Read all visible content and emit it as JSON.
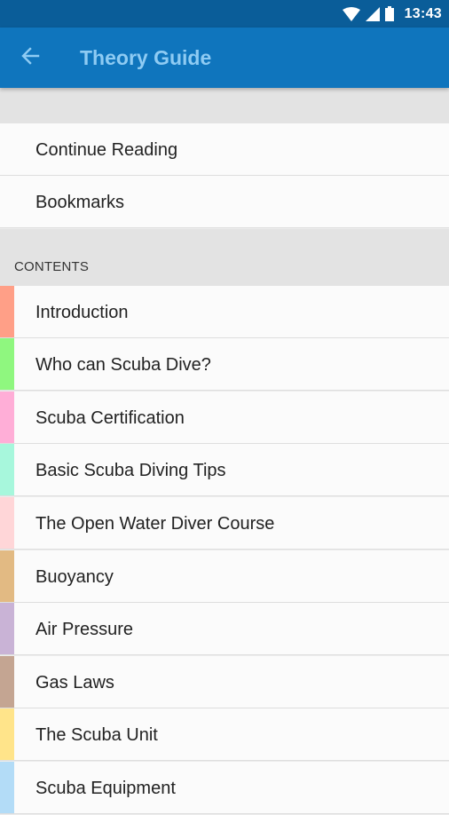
{
  "status_bar": {
    "time": "13:43",
    "icons": [
      "wifi-icon",
      "signal-icon",
      "battery-icon"
    ]
  },
  "app_bar": {
    "title": "Theory Guide",
    "back_icon": "arrow-back-icon",
    "background": "#0f75bd",
    "title_color": "#8ecbf3"
  },
  "menu": {
    "continue_reading": "Continue Reading",
    "bookmarks": "Bookmarks"
  },
  "contents": {
    "header": "CONTENTS",
    "items": [
      {
        "label": "Introduction",
        "color": "#ff9f87"
      },
      {
        "label": "Who can Scuba Dive?",
        "color": "#8ff77f"
      },
      {
        "label": "Scuba Certification",
        "color": "#ffaed7"
      },
      {
        "label": "Basic Scuba Diving Tips",
        "color": "#a7f7dc"
      },
      {
        "label": "The Open Water Diver Course",
        "color": "#ffd6d8"
      },
      {
        "label": "Buoyancy",
        "color": "#e2ba83"
      },
      {
        "label": "Air Pressure",
        "color": "#c9b3d6"
      },
      {
        "label": "Gas Laws",
        "color": "#c4a592"
      },
      {
        "label": "The Scuba Unit",
        "color": "#ffe48a"
      },
      {
        "label": "Scuba Equipment",
        "color": "#b3dcf7"
      }
    ]
  }
}
